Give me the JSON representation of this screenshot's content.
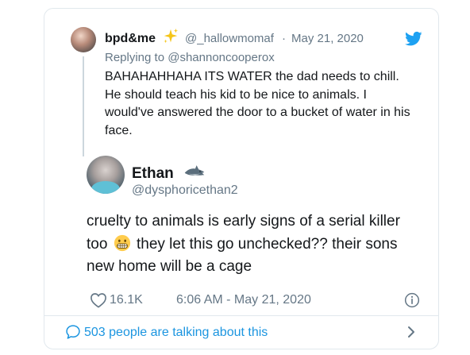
{
  "quoted_tweet": {
    "display_name": "bpd&me",
    "display_name_emoji": "sparkles-icon",
    "handle": "@_hallowmomaf",
    "separator": "·",
    "date": "May 21, 2020",
    "replying_prefix": "Replying to",
    "replying_handle": "@shannoncooperox",
    "text": "BAHAHAHHAHA ITS WATER the dad needs to chill. He should teach his kid to be nice to animals. I would've answered the door to a bucket of water in his face."
  },
  "main_tweet": {
    "display_name": "Ethan",
    "display_name_emoji": "shark-icon",
    "handle": "@dysphoricethan2",
    "text_part1": "cruelty to animals is early signs of a serial killer too",
    "emoji": "grimacing-face-icon",
    "text_part2": "they let this go unchecked?? their sons new home will be a cage",
    "likes": "16.1K",
    "timestamp": "6:06 AM - May 21, 2020"
  },
  "footer": {
    "conversation_text": "503 people are talking about this"
  },
  "colors": {
    "text": "#14171a",
    "secondary": "#657786",
    "link": "#1b95e0",
    "twitter_blue": "#1da1f2",
    "border": "#e1e8ed"
  }
}
